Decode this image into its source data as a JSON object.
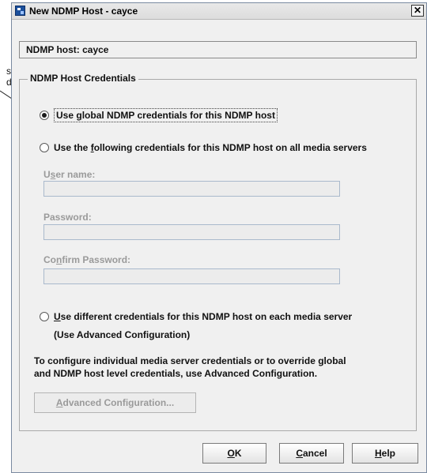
{
  "callout": {
    "fragment_1": "s",
    "fragment_2": "d"
  },
  "window": {
    "title": "New NDMP Host - cayce",
    "close_glyph": "✕"
  },
  "host": {
    "label": "NDMP host: cayce"
  },
  "credentials": {
    "group_title": "NDMP Host Credentials",
    "option_global": {
      "label": "Use global NDMP credentials for this NDMP host",
      "checked": true
    },
    "option_following": {
      "prefix": "Use the ",
      "mnemonic": "f",
      "suffix": "ollowing credentials for this NDMP host on all media servers",
      "checked": false
    },
    "username": {
      "prefix": "U",
      "mnemonic": "s",
      "suffix": "er name:",
      "value": ""
    },
    "password": {
      "label": "Password:",
      "value": ""
    },
    "confirm_password": {
      "prefix": "Co",
      "mnemonic": "n",
      "suffix": "firm Password:",
      "value": ""
    },
    "option_different": {
      "mnemonic": "U",
      "suffix": "se different credentials for this NDMP host on each media server",
      "line2": "(Use Advanced Configuration)",
      "checked": false
    },
    "note_line1": "To configure individual media server credentials or to override global",
    "note_line2": "and NDMP host level credentials, use Advanced Configuration.",
    "advanced_button": {
      "mnemonic": "A",
      "suffix": "dvanced Configuration..."
    }
  },
  "buttons": {
    "ok": {
      "mnemonic": "O",
      "suffix": "K"
    },
    "cancel": {
      "mnemonic": "C",
      "suffix": "ancel"
    },
    "help": {
      "mnemonic": "H",
      "suffix": "elp"
    }
  }
}
